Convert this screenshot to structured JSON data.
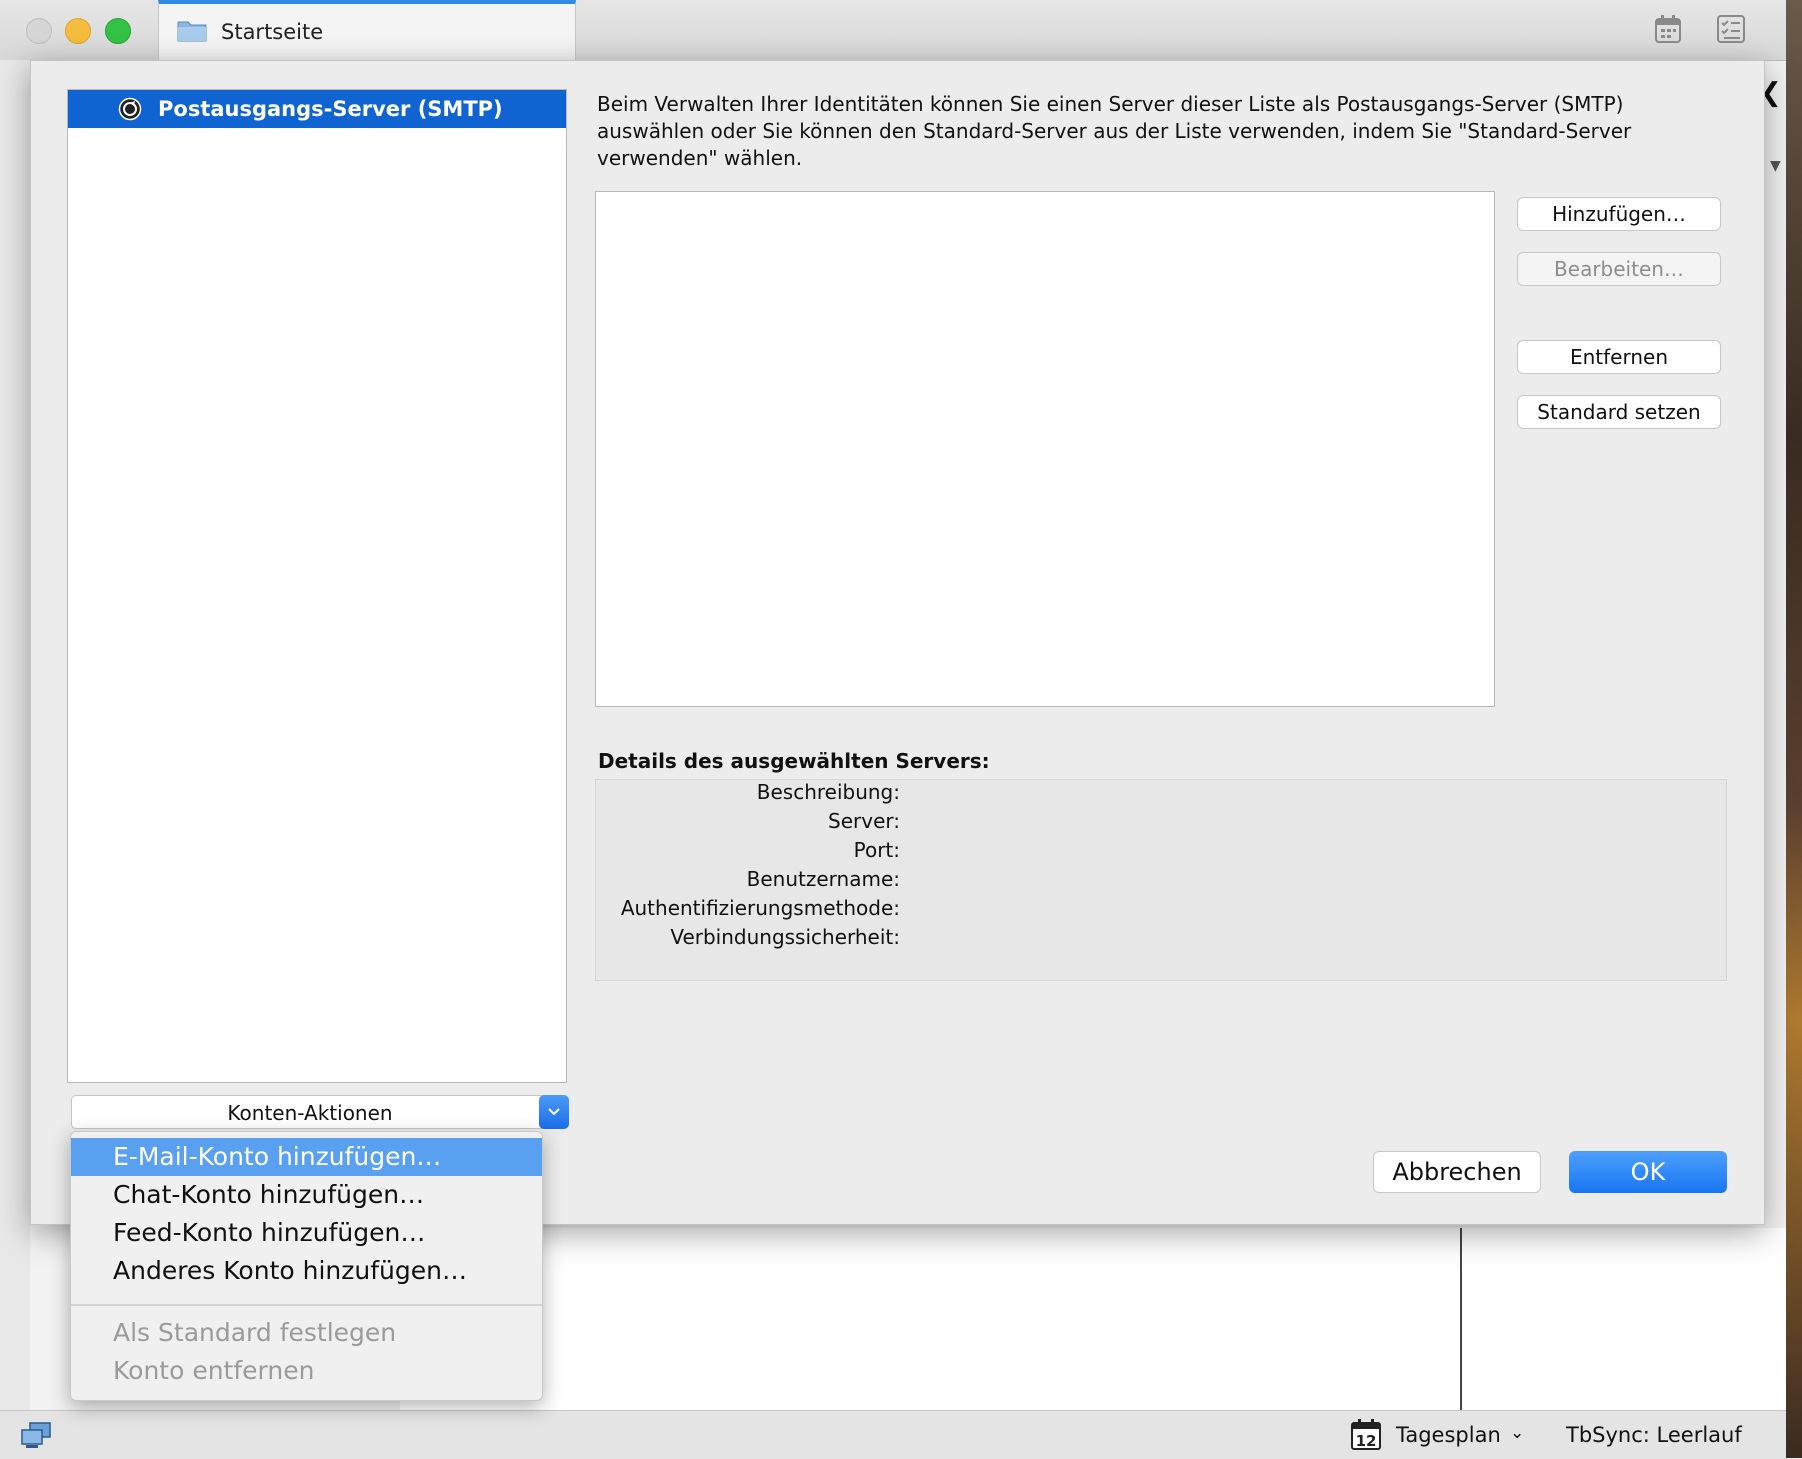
{
  "window": {
    "tab_title": "Startseite"
  },
  "tree": {
    "selected_item": "Postausgangs-Server (SMTP)"
  },
  "account_actions": {
    "label": "Konten-Aktionen"
  },
  "menu": {
    "items": [
      {
        "label": "E-Mail-Konto hinzufügen…",
        "state": "highlighted"
      },
      {
        "label": "Chat-Konto hinzufügen…",
        "state": "enabled"
      },
      {
        "label": "Feed-Konto hinzufügen…",
        "state": "enabled"
      },
      {
        "label": "Anderes Konto hinzufügen…",
        "state": "enabled"
      },
      {
        "label": "Als Standard festlegen",
        "state": "disabled"
      },
      {
        "label": "Konto entfernen",
        "state": "disabled"
      }
    ]
  },
  "smtp": {
    "description": "Beim Verwalten Ihrer Identitäten können Sie einen Server dieser Liste als Postausgangs-Server (SMTP) auswählen oder Sie können den Standard-Server aus der Liste verwenden, indem Sie \"Standard-Server verwenden\" wählen.",
    "buttons": {
      "add": "Hinzufügen…",
      "edit": "Bearbeiten…",
      "remove": "Entfernen",
      "set_default": "Standard setzen"
    },
    "details_title": "Details des ausgewählten Servers:",
    "details_labels": {
      "description": "Beschreibung:",
      "server": "Server:",
      "port": "Port:",
      "username": "Benutzername:",
      "auth_method": "Authentifizierungsmethode:",
      "security": "Verbindungssicherheit:"
    }
  },
  "dialog_buttons": {
    "cancel": "Abbrechen",
    "ok": "OK"
  },
  "statusbar": {
    "today_pane": "Tagesplan",
    "calendar_day": "12",
    "sync_status": "TbSync: Leerlauf"
  },
  "colors": {
    "selection": "#0f64d2",
    "menu_highlight": "#5aa0f0",
    "ok_button": "#1876f2"
  }
}
